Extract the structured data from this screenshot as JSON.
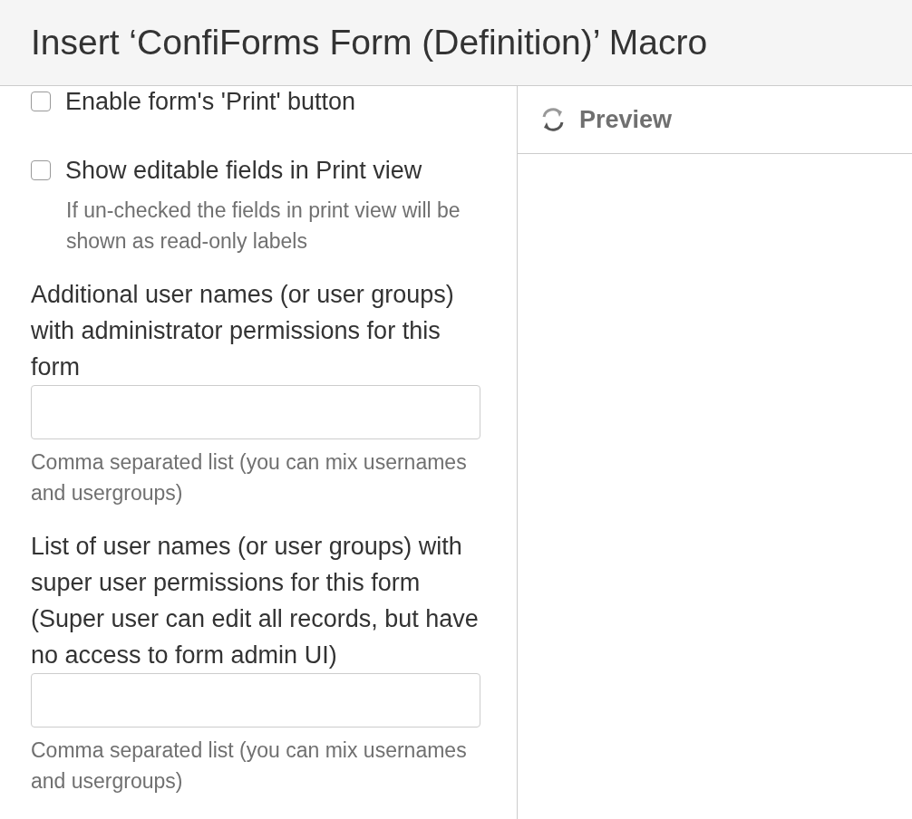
{
  "dialog": {
    "title": "Insert ‘ConfiForms Form (Definition)’ Macro"
  },
  "options": [
    {
      "kind": "checkbox",
      "label": "Enable form's 'Print' button",
      "checked": false
    },
    {
      "kind": "checkbox",
      "label": "Show editable fields in Print view",
      "checked": false,
      "help": "If un-checked the fields in print view will be shown as read-only labels"
    },
    {
      "kind": "text",
      "label": "Additional user names (or user groups) with administrator permissions for this form",
      "help": "Comma separated list (you can mix usernames and usergroups)"
    },
    {
      "kind": "text",
      "label": "List of user names (or user groups) with super user permissions for this form (Super user can edit all records, but have no access to form admin UI)",
      "help": "Comma separated list (you can mix usernames and usergroups)"
    }
  ],
  "preview": {
    "label": "Preview"
  }
}
